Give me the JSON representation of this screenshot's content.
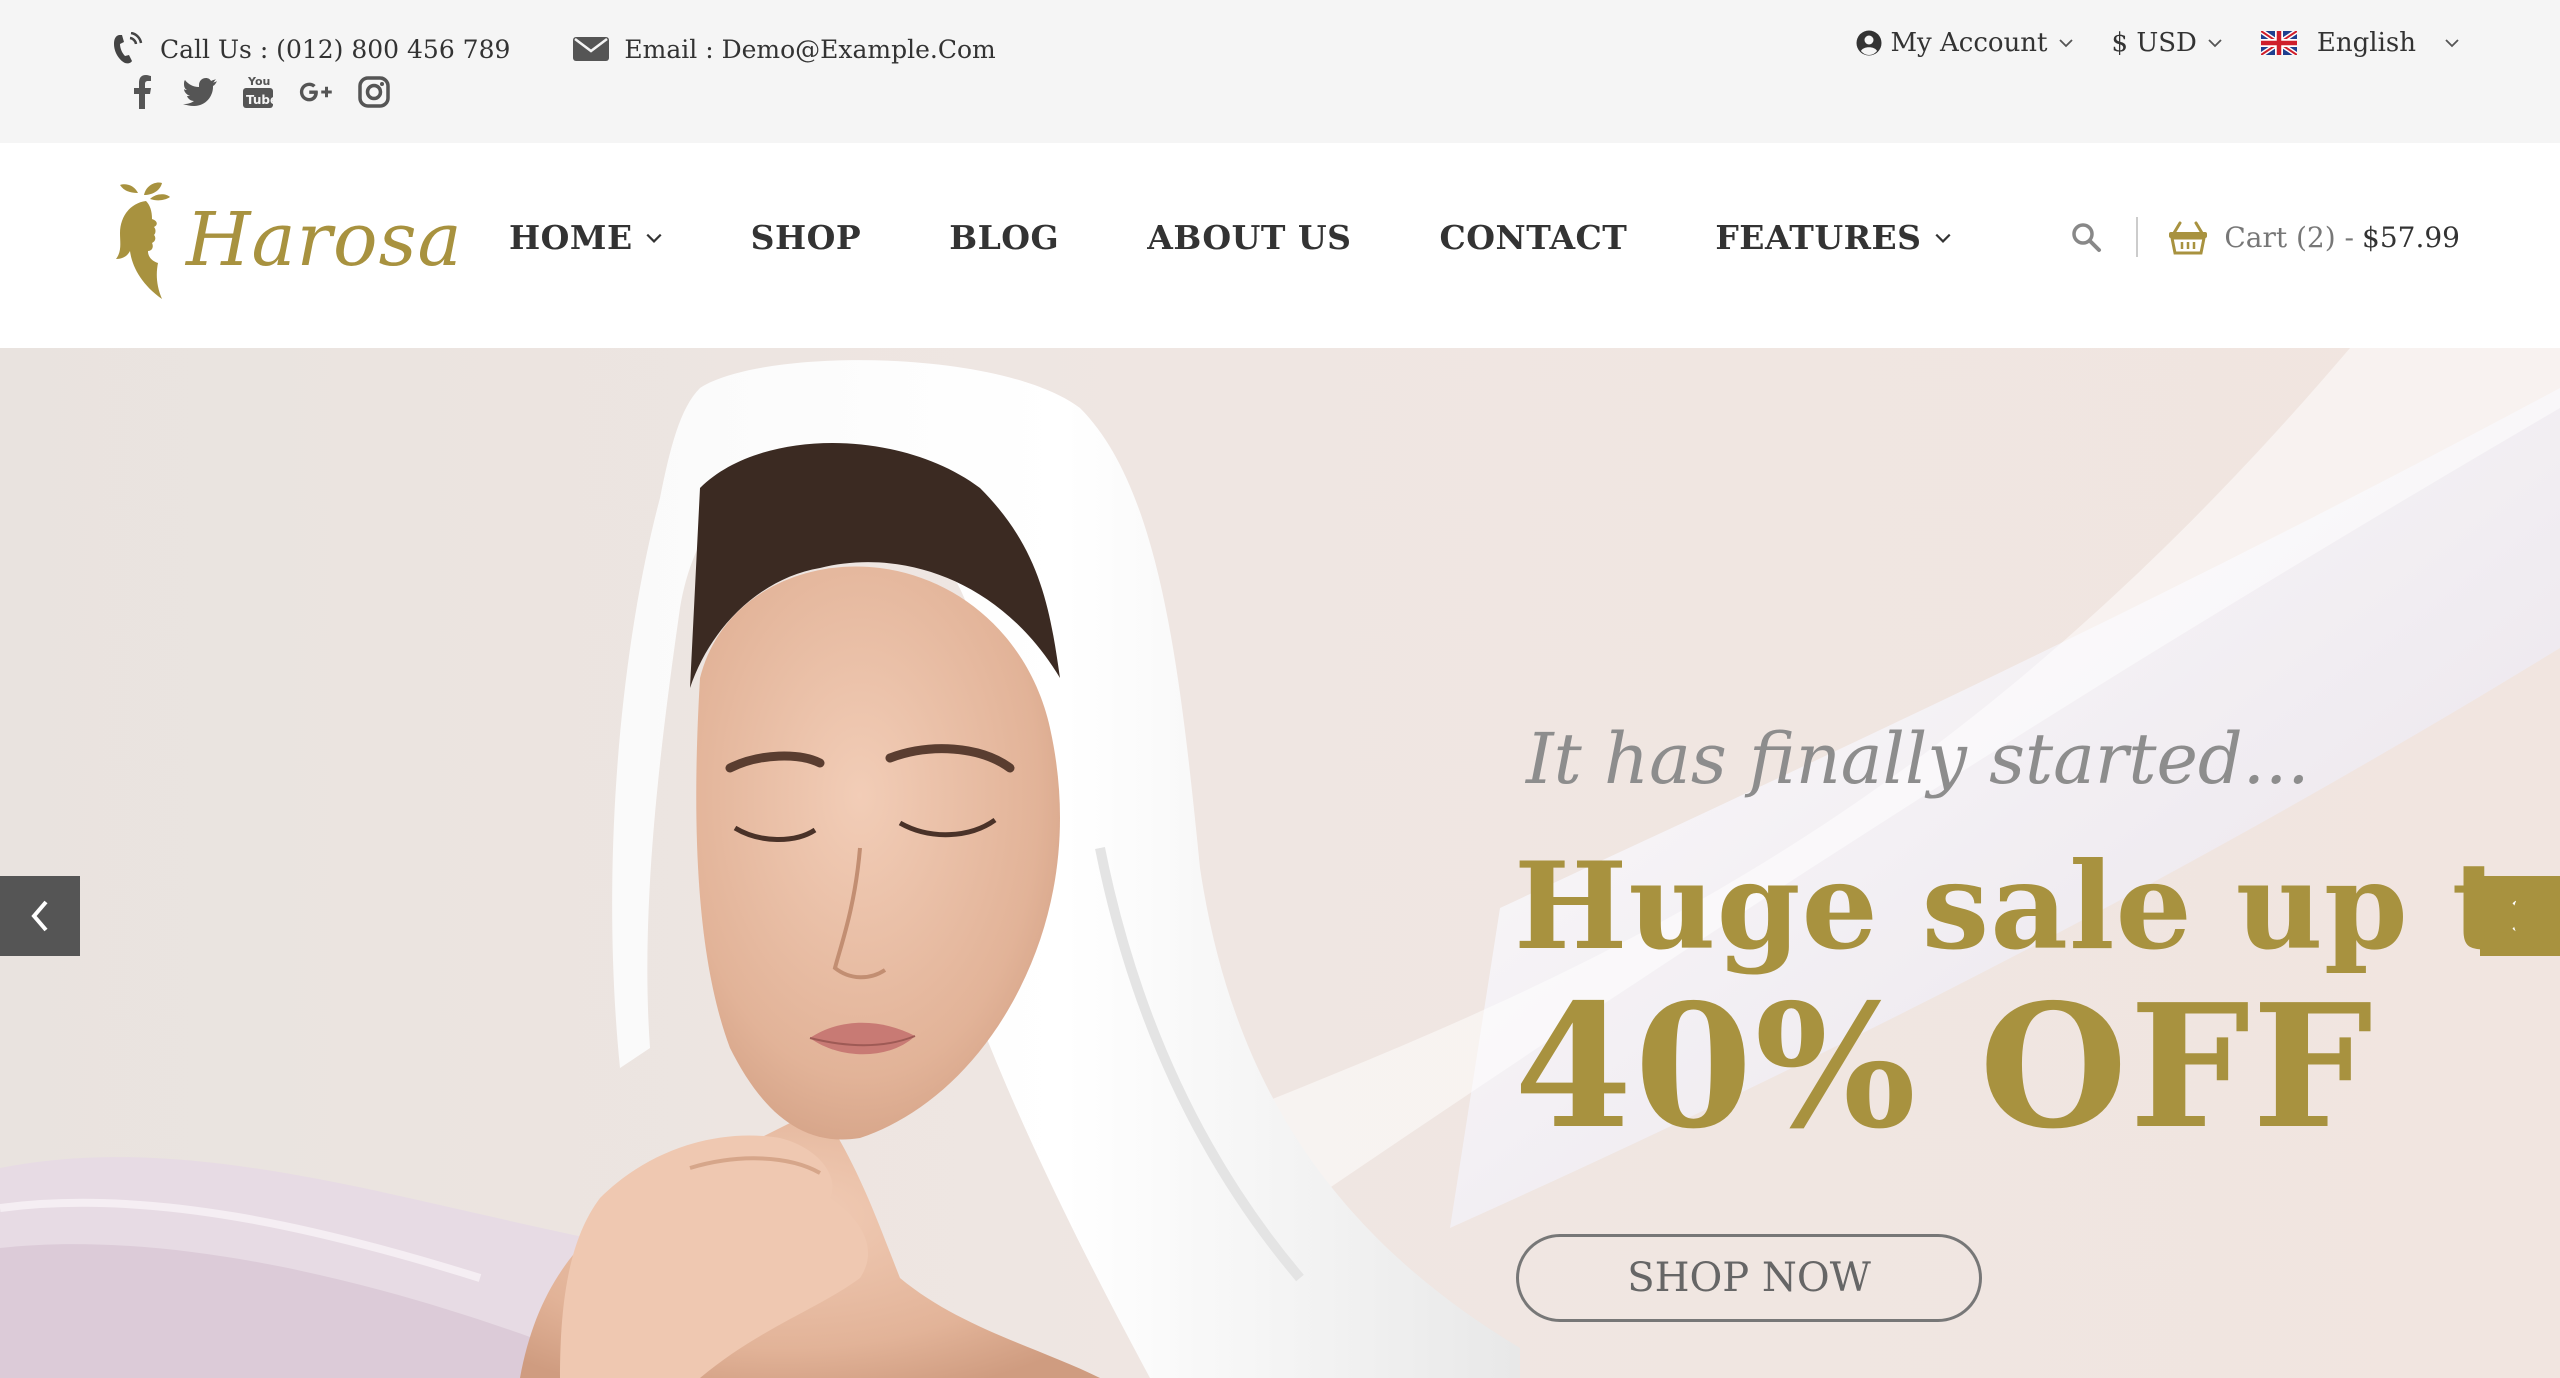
{
  "topbar": {
    "phone": {
      "icon": "phone-icon",
      "label": "Call Us : (012) 800 456 789"
    },
    "email": {
      "icon": "envelope-icon",
      "label": "Email : Demo@Example.Com"
    },
    "social": [
      "facebook-icon",
      "twitter-icon",
      "youtube-icon",
      "google-plus-icon",
      "instagram-icon"
    ],
    "account_label": "My Account",
    "currency_label": "$ USD",
    "language_label": "English"
  },
  "header": {
    "logo_text": "Harosa",
    "nav": [
      {
        "label": "HOME",
        "has_dropdown": true
      },
      {
        "label": "SHOP",
        "has_dropdown": false
      },
      {
        "label": "BLOG",
        "has_dropdown": false
      },
      {
        "label": "ABOUT US",
        "has_dropdown": false
      },
      {
        "label": "CONTACT",
        "has_dropdown": false
      },
      {
        "label": "FEATURES",
        "has_dropdown": true
      }
    ],
    "cart_label": "Cart (2) -",
    "cart_total": "$57.99"
  },
  "hero": {
    "subtitle": "It has finally started...",
    "title_line1": "Huge sale up to",
    "title_line2": "40% OFF",
    "button_label": "SHOP NOW"
  },
  "colors": {
    "accent": "#a8923f",
    "topbar_bg": "#f5f5f5",
    "text": "#333333",
    "muted": "#8d8d8d"
  }
}
